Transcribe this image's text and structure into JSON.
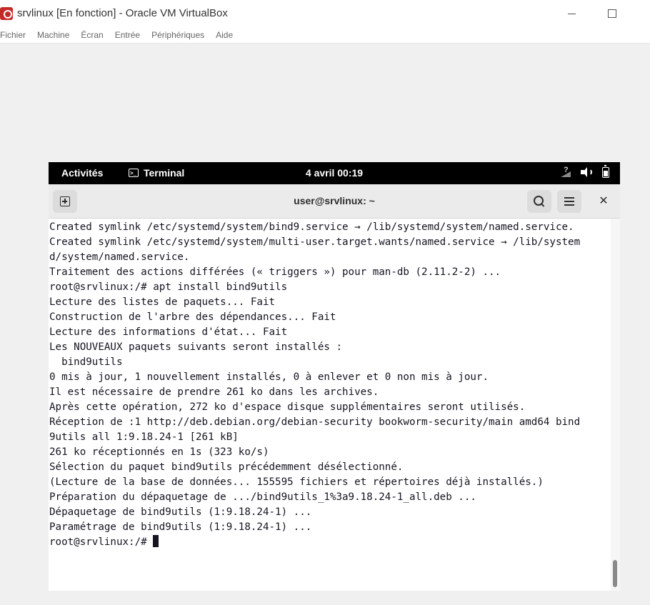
{
  "window": {
    "title": "srvlinux [En fonction] - Oracle VM VirtualBox",
    "app_icon": "virtualbox-icon"
  },
  "vbox_menu": [
    "Fichier",
    "Machine",
    "Écran",
    "Entrée",
    "Périphériques",
    "Aide"
  ],
  "gnome_bar": {
    "activities": "Activités",
    "app_name": "Terminal",
    "clock": "4 avril  00:19",
    "term_icon_glyph": ">_"
  },
  "terminal": {
    "title": "user@srvlinux: ~",
    "lines": [
      "Created symlink /etc/systemd/system/bind9.service → /lib/systemd/system/named.service.",
      "Created symlink /etc/systemd/system/multi-user.target.wants/named.service → /lib/system",
      "d/system/named.service.",
      "Traitement des actions différées (« triggers ») pour man-db (2.11.2-2) ...",
      "root@srvlinux:/# apt install bind9utils",
      "Lecture des listes de paquets... Fait",
      "Construction de l'arbre des dépendances... Fait",
      "Lecture des informations d'état... Fait",
      "Les NOUVEAUX paquets suivants seront installés :",
      "  bind9utils",
      "0 mis à jour, 1 nouvellement installés, 0 à enlever et 0 non mis à jour.",
      "Il est nécessaire de prendre 261 ko dans les archives.",
      "Après cette opération, 272 ko d'espace disque supplémentaires seront utilisés.",
      "Réception de :1 http://deb.debian.org/debian-security bookworm-security/main amd64 bind",
      "9utils all 1:9.18.24-1 [261 kB]",
      "261 ko réceptionnés en 1s (323 ko/s)",
      "Sélection du paquet bind9utils précédemment désélectionné.",
      "(Lecture de la base de données... 155595 fichiers et répertoires déjà installés.)",
      "Préparation du dépaquetage de .../bind9utils_1%3a9.18.24-1_all.deb ...",
      "Dépaquetage de bind9utils (1:9.18.24-1) ...",
      "Paramétrage de bind9utils (1:9.18.24-1) ..."
    ],
    "prompt": "root@srvlinux:/# "
  }
}
